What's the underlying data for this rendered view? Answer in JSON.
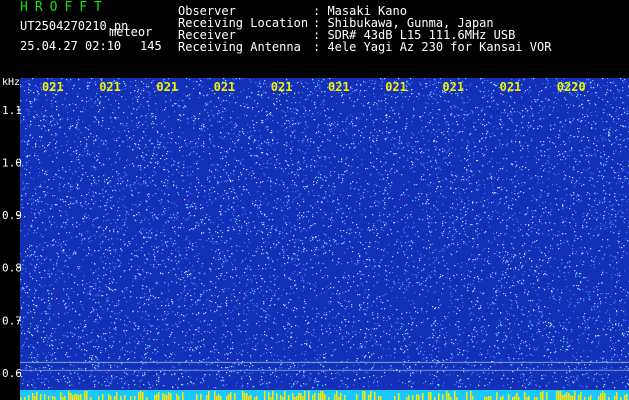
{
  "header": {
    "app_title": "HROFFT",
    "file_name": "UT2504270210.pn",
    "mode": "meteor",
    "date_time": "25.04.27 02:10",
    "count": "145",
    "info_rows": [
      {
        "label": "Observer",
        "value": ": Masaki Kano"
      },
      {
        "label": "Receiving Location",
        "value": ": Shibukawa, Gunma, Japan"
      },
      {
        "label": "Receiver",
        "value": ": SDR# 43dB L15 111.6MHz USB"
      },
      {
        "label": "Receiving Antenna",
        "value": ": 4ele Yagi Az 230 for Kansai VOR"
      }
    ]
  },
  "chart_data": {
    "type": "heatmap",
    "ylabel": "kHz",
    "y_ticks": [
      "1.1",
      "1.0",
      "0.9",
      "0.8",
      "0.7",
      "0.6"
    ],
    "y_tick_values": [
      1.1,
      1.0,
      0.9,
      0.8,
      0.7,
      0.6
    ],
    "ylim": [
      0.575,
      1.155
    ],
    "x_ticks": [
      "021",
      "021",
      "021",
      "021",
      "021",
      "021",
      "021",
      "021",
      "021",
      "0220"
    ],
    "x_tick_minutes": [
      10,
      11,
      12,
      13,
      14,
      15,
      16,
      17,
      18,
      19,
      20
    ],
    "xlim": [
      10,
      20
    ],
    "reference_lines_khz": [
      0.62,
      0.605
    ],
    "colors": {
      "background": "#1530b8",
      "noise_light": "#3d78ff",
      "noise_cyan": "#4fd8ff",
      "noise_white": "#b8f0ff",
      "axis_text": "#ffffff",
      "tick_label": "#f5f000",
      "bottom_band": "#18c8ff",
      "bottom_band_peak": "#ffe600"
    }
  }
}
